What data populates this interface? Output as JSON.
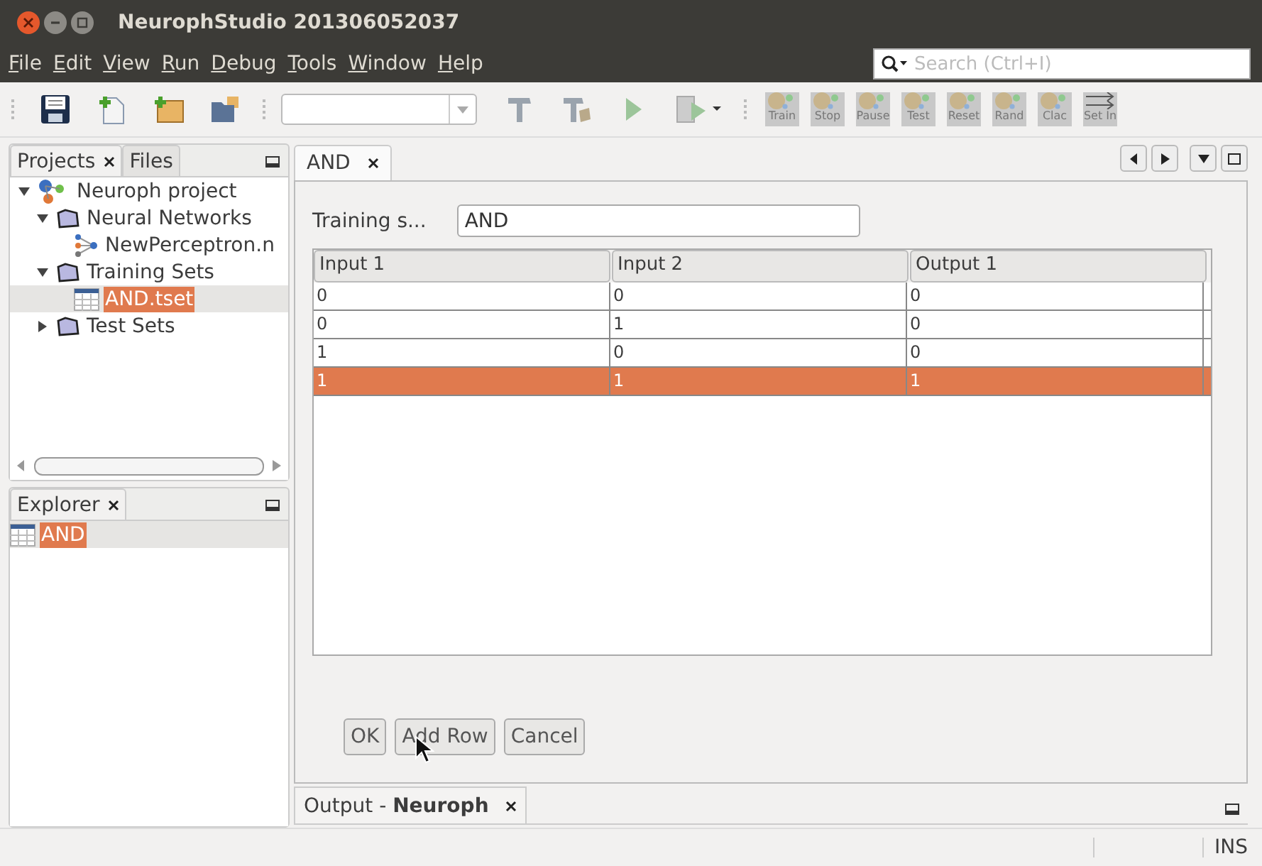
{
  "window": {
    "title": "NeurophStudio 201306052037"
  },
  "menu": [
    "File",
    "Edit",
    "View",
    "Run",
    "Debug",
    "Tools",
    "Window",
    "Help"
  ],
  "search": {
    "placeholder": "Search (Ctrl+I)"
  },
  "toolbar": [
    {
      "kind": "save"
    },
    {
      "kind": "new-file"
    },
    {
      "kind": "new-project"
    },
    {
      "kind": "open-project"
    },
    {
      "kind": "combo"
    },
    {
      "kind": "build"
    },
    {
      "kind": "clean-build"
    },
    {
      "kind": "run"
    },
    {
      "kind": "run-file"
    },
    {
      "kind": "labeled",
      "label": "Train"
    },
    {
      "kind": "labeled",
      "label": "Stop"
    },
    {
      "kind": "labeled",
      "label": "Pause"
    },
    {
      "kind": "labeled",
      "label": "Test"
    },
    {
      "kind": "labeled",
      "label": "Reset"
    },
    {
      "kind": "labeled",
      "label": "Rand"
    },
    {
      "kind": "labeled",
      "label": "Clac"
    },
    {
      "kind": "arrows",
      "label": "Set In"
    }
  ],
  "projects_panel": {
    "tabs": [
      {
        "label": "Projects",
        "selected": true,
        "closable": true
      },
      {
        "label": "Files",
        "selected": false,
        "closable": false
      }
    ],
    "tree": [
      {
        "label": "Neuroph project",
        "kind": "project",
        "expanded": true,
        "selected": false,
        "children": [
          {
            "label": "Neural Networks",
            "kind": "folder",
            "expanded": true,
            "selected": false,
            "children": [
              {
                "label": "NewPerceptron.n",
                "kind": "network",
                "selected": false
              }
            ]
          },
          {
            "label": "Training Sets",
            "kind": "folder",
            "expanded": true,
            "selected": false,
            "children": [
              {
                "label": "AND.tset",
                "kind": "tset",
                "selected": true
              }
            ]
          },
          {
            "label": "Test Sets",
            "kind": "folder",
            "expanded": false,
            "selected": false
          }
        ]
      }
    ]
  },
  "explorer_panel": {
    "tabs": [
      {
        "label": "Explorer",
        "selected": true,
        "closable": true
      }
    ],
    "items": [
      {
        "label": "AND",
        "selected": true
      }
    ]
  },
  "editor": {
    "tabs": [
      {
        "label": "AND"
      }
    ],
    "name_label": "Training s...",
    "name_value": "AND",
    "table": {
      "columns": [
        "Input 1",
        "Input 2",
        "Output 1"
      ],
      "rows": [
        {
          "cells": [
            "0",
            "0",
            "0"
          ],
          "selected": false
        },
        {
          "cells": [
            "0",
            "1",
            "0"
          ],
          "selected": false
        },
        {
          "cells": [
            "1",
            "0",
            "0"
          ],
          "selected": false
        },
        {
          "cells": [
            "1",
            "1",
            "1"
          ],
          "selected": true
        }
      ]
    },
    "buttons": [
      "OK",
      "Add Row",
      "Cancel"
    ]
  },
  "output_panel": {
    "tabs": [
      {
        "label": "Output - **Neuroph**"
      }
    ]
  },
  "status_bar": {
    "mode": "INS"
  }
}
